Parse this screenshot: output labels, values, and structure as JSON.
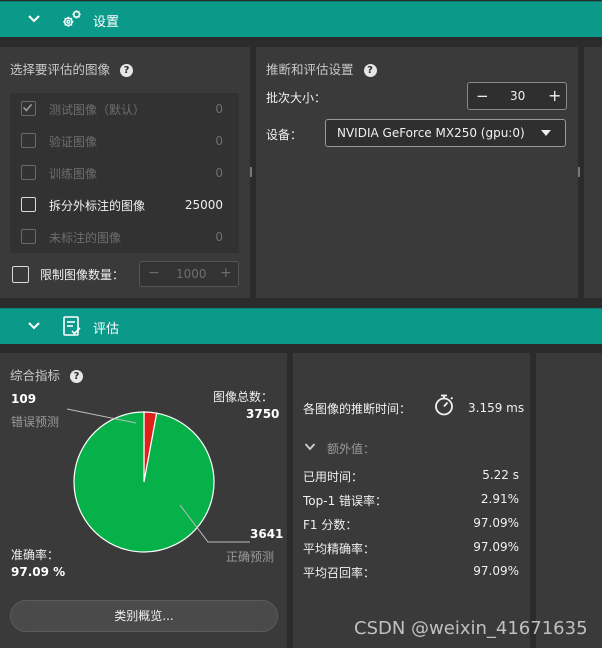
{
  "settings_header": {
    "title": "设置",
    "icon": "gear-icon"
  },
  "select_images": {
    "title": "选择要评估的图像",
    "items": [
      {
        "label": "测试图像（默认）",
        "count": "0",
        "checked": true,
        "enabled": false
      },
      {
        "label": "验证图像",
        "count": "0",
        "checked": false,
        "enabled": false
      },
      {
        "label": "训练图像",
        "count": "0",
        "checked": false,
        "enabled": false
      },
      {
        "label": "拆分外标注的图像",
        "count": "25000",
        "checked": false,
        "enabled": true
      },
      {
        "label": "未标注的图像",
        "count": "0",
        "checked": false,
        "enabled": false
      }
    ],
    "limit_label": "限制图像数量：",
    "limit_value": "1000",
    "minus": "−",
    "plus": "+"
  },
  "inference": {
    "title": "推断和评估设置",
    "batch_label": "批次大小：",
    "batch_value": "30",
    "minus": "−",
    "plus": "+",
    "device_label": "设备：",
    "device_value": "NVIDIA GeForce MX250 (gpu:0)"
  },
  "eval_header": {
    "title": "评估",
    "icon": "clipboard-check-icon"
  },
  "metrics": {
    "title": "综合指标",
    "wrong_count": "109",
    "wrong_label": "错误预测",
    "total_label": "图像总数：",
    "total_value": "3750",
    "correct_count": "3641",
    "correct_label": "正确预测",
    "accuracy_label": "准确率：",
    "accuracy_value": "97.09 %",
    "class_overview_button": "类别概览..."
  },
  "chart_data": {
    "type": "pie",
    "categories": [
      "错误预测",
      "正确预测"
    ],
    "values": [
      109,
      3641
    ],
    "colors": [
      "#e0201b",
      "#07b14a"
    ]
  },
  "timing": {
    "per_image_label": "各图像的推断时间：",
    "per_image_value": "3.159 ms",
    "extra_label": "额外值：",
    "rows": [
      {
        "label": "已用时间：",
        "value": "5.22 s"
      },
      {
        "label": "Top-1 错误率：",
        "value": "2.91%"
      },
      {
        "label": "F1 分数：",
        "value": "97.09%"
      },
      {
        "label": "平均精确率：",
        "value": "97.09%"
      },
      {
        "label": "平均召回率：",
        "value": "97.09%"
      }
    ]
  },
  "watermark": "CSDN @weixin_41671635"
}
